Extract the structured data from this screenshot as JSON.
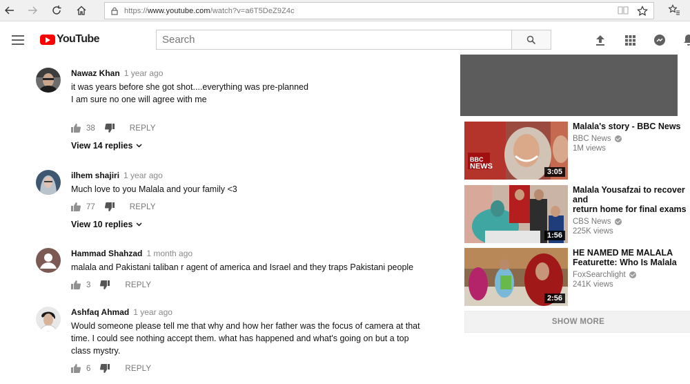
{
  "browser": {
    "url_prefix": "https://",
    "url_host": "www.youtube.com",
    "url_path": "/watch?v=a6T5DeZ9Z4c"
  },
  "header": {
    "logo_text": "YouTube",
    "search_placeholder": "Search"
  },
  "comments": [
    {
      "author": "Nawaz Khan",
      "time": "1 year ago",
      "text_lines": [
        "it was  years before she got shot....everything was pre-planned",
        "I am sure no one will agree with me"
      ],
      "likes": "38",
      "reply_label": "REPLY",
      "view_replies": "View 14 replies"
    },
    {
      "author": "ilhem shajiri",
      "time": "1 year ago",
      "text_lines": [
        "Much love to you Malala and your family <3"
      ],
      "likes": "77",
      "reply_label": "REPLY",
      "view_replies": "View 10 replies"
    },
    {
      "author": "Hammad Shahzad",
      "time": "1 month ago",
      "text_lines": [
        "malala and Pakistani taliban r agent of america and Israel and they traps Pakistani people"
      ],
      "likes": "3",
      "reply_label": "REPLY"
    },
    {
      "author": "Ashfaq Ahmad",
      "time": "1 year ago",
      "text_lines": [
        "Would someone please tell me that why and how her father was the focus of camera at that",
        "time. I could see nothing accept them. what has happened and what's going on but a top",
        "class mystry."
      ],
      "likes": "6",
      "reply_label": "REPLY"
    }
  ],
  "related": [
    {
      "title_lines": [
        "Malala's story - BBC News"
      ],
      "channel": "BBC News",
      "views": "1M views",
      "duration": "3:05",
      "badge_text": [
        "BBC",
        "NEWS"
      ]
    },
    {
      "title_lines": [
        "Malala Yousafzai to recover and",
        "return home for final exams"
      ],
      "channel": "CBS News",
      "views": "225K views",
      "duration": "1:56"
    },
    {
      "title_lines": [
        "HE NAMED ME MALALA",
        "Featurette: Who Is Malala"
      ],
      "channel": "FoxSearchlight",
      "views": "241K views",
      "duration": "2:56"
    }
  ],
  "show_more": "SHOW MORE"
}
